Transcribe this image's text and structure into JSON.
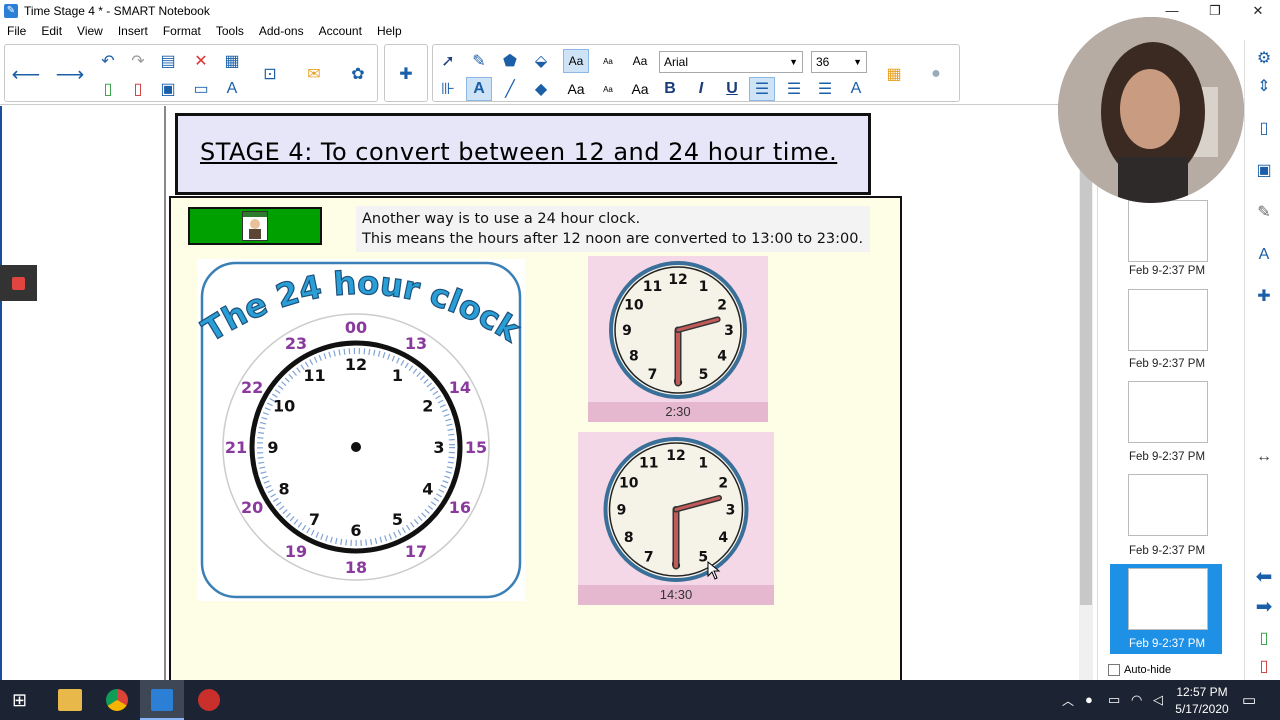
{
  "window": {
    "title": "Time Stage 4 * - SMART Notebook",
    "app_icon": "smart-notebook-icon",
    "minimize": "—",
    "restore": "❐",
    "close": "✕"
  },
  "menu": [
    "File",
    "Edit",
    "View",
    "Insert",
    "Format",
    "Tools",
    "Add-ons",
    "Account",
    "Help"
  ],
  "toolbar": {
    "font_name": "Arial",
    "font_size": "36",
    "text_style_labels": [
      "Aa",
      "Aa",
      "Aa",
      "Aa",
      "Aa",
      "Aa"
    ],
    "bold": "B",
    "italic": "I",
    "underline": "U"
  },
  "page": {
    "title": "STAGE 4: To convert between 12 and 24 hour time.",
    "note_line1": "Another way is to use a 24 hour clock.",
    "note_line2": "This means the hours after 12 noon are converted to 13:00 to 23:00.",
    "clock_card": {
      "heading": "The 24 hour clock",
      "hours12": [
        "12",
        "1",
        "2",
        "3",
        "4",
        "5",
        "6",
        "7",
        "8",
        "9",
        "10",
        "11"
      ],
      "hours24": [
        "00",
        "13",
        "14",
        "15",
        "16",
        "17",
        "18",
        "19",
        "20",
        "21",
        "22",
        "23"
      ]
    },
    "clocks": [
      {
        "label": "2:30",
        "hour": 2,
        "minute": 30
      },
      {
        "label": "14:30",
        "hour": 2,
        "minute": 30
      }
    ]
  },
  "thumbnails": [
    {
      "label": "Feb 9-2:37 PM"
    },
    {
      "label": "Feb 9-2:37 PM"
    },
    {
      "label": "Feb 9-2:37 PM"
    },
    {
      "label": "Feb 9-2:37 PM"
    },
    {
      "label": "Feb 9-2:37 PM",
      "selected": true
    }
  ],
  "autohide_label": "Auto-hide",
  "taskbar": {
    "time": "12:57 PM",
    "date": "5/17/2020"
  },
  "colors": {
    "accent": "#1e90e6",
    "page_bg": "#fefee6",
    "clock_panel": "#f4d8e8",
    "green_box": "#00a000"
  }
}
